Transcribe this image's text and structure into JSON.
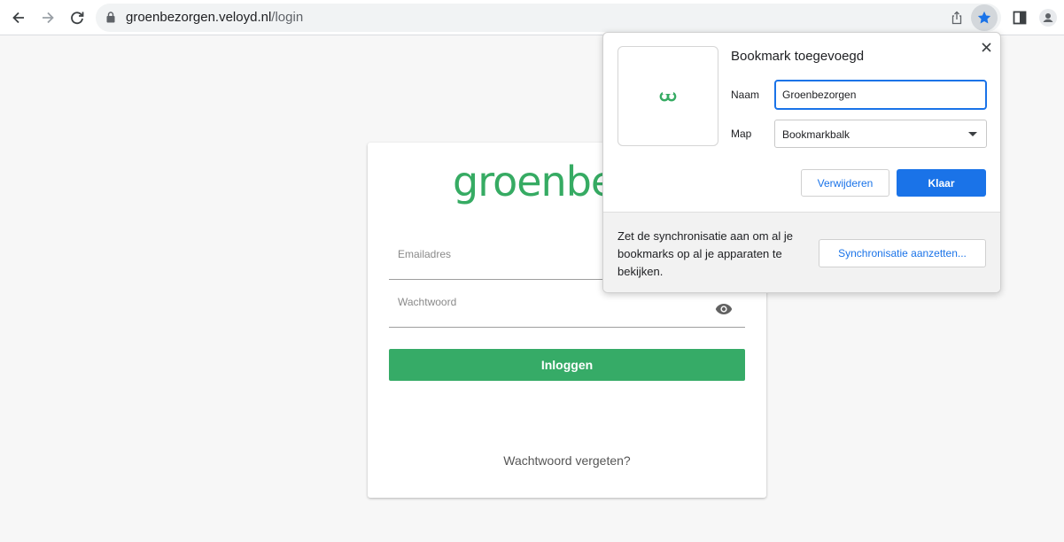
{
  "browser": {
    "url_host": "groenbezorgen.veloyd.nl",
    "url_path": "/login",
    "icons": [
      "back-arrow-icon",
      "forward-arrow-icon",
      "reload-icon",
      "lock-icon",
      "share-icon",
      "star-icon",
      "side-panel-icon",
      "profile-icon"
    ]
  },
  "login": {
    "logo_text": "groenbezorgen",
    "email_label": "Emailadres",
    "password_label": "Wachtwoord",
    "login_button": "Inloggen",
    "forgot_link": "Wachtwoord vergeten?",
    "brand_color": "#36ab63"
  },
  "bookmark_popup": {
    "title": "Bookmark toegevoegd",
    "name_label": "Naam",
    "name_value": "Groenbezorgen",
    "folder_label": "Map",
    "folder_value": "Bookmarkbalk",
    "remove_button": "Verwijderen",
    "done_button": "Klaar",
    "sync_text": "Zet de synchronisatie aan om al je bookmarks op al je apparaten te bekijken.",
    "sync_button": "Synchronisatie aanzetten...",
    "accent_color": "#1a73e8"
  }
}
